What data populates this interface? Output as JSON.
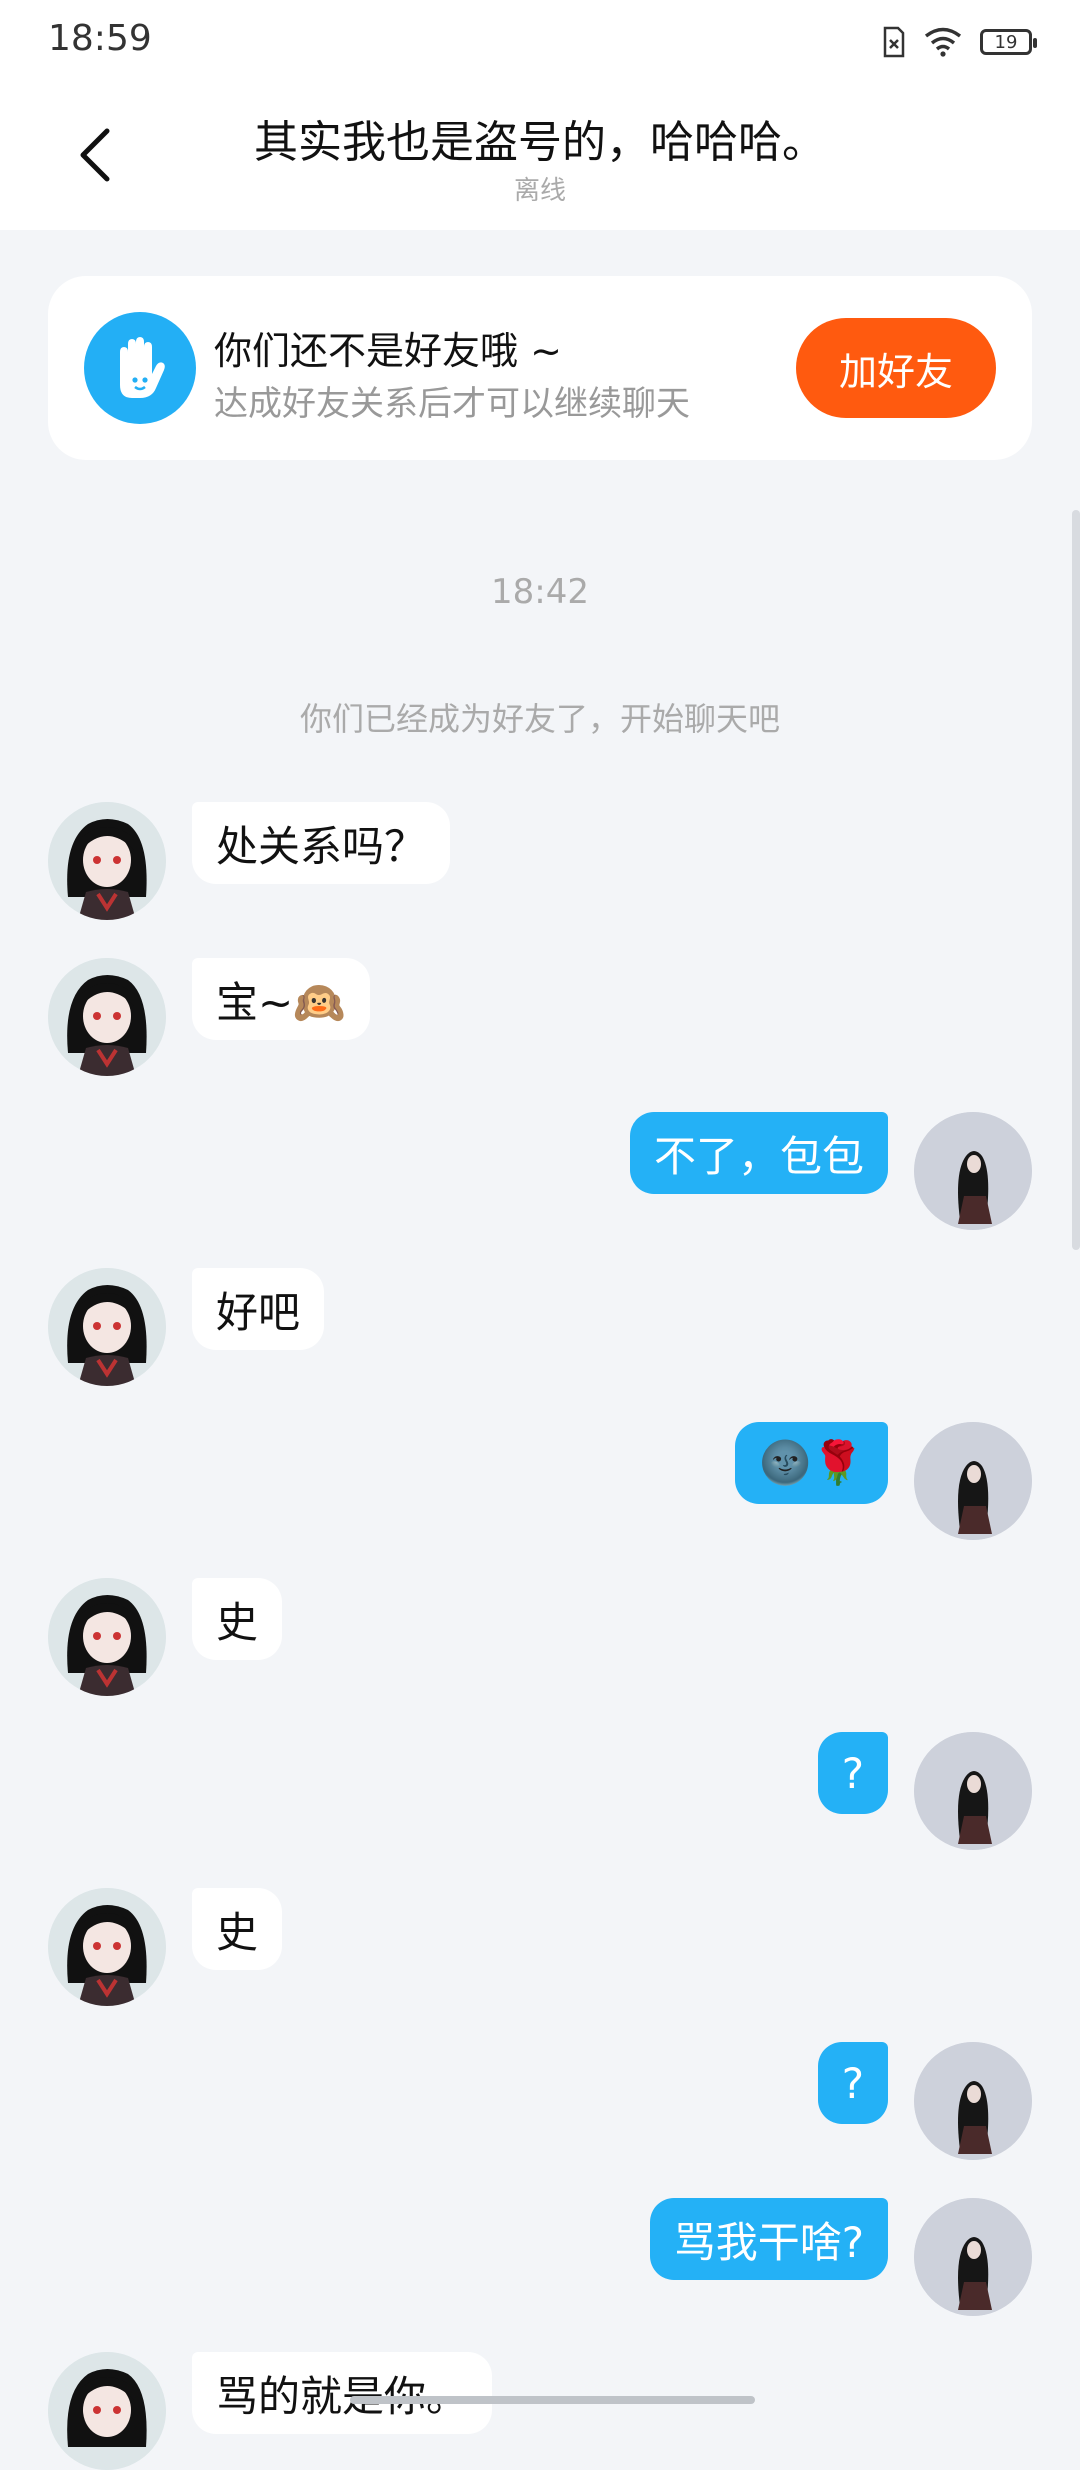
{
  "status": {
    "time": "18:59",
    "battery": "19"
  },
  "header": {
    "title": "其实我也是盗号的，哈哈哈。",
    "subtitle": "离线"
  },
  "friend_card": {
    "title": "你们还不是好友哦 ~",
    "subtitle": "达成好友关系后才可以继续聊天",
    "button": "加好友"
  },
  "chat": {
    "time": "18:42",
    "system": "你们已经成为好友了，开始聊天吧",
    "messages": [
      {
        "side": "left",
        "text": "处关系吗？"
      },
      {
        "side": "left",
        "text": "宝~🙉"
      },
      {
        "side": "right",
        "text": "不了，包包"
      },
      {
        "side": "left",
        "text": "好吧"
      },
      {
        "side": "right",
        "text": "🌚🌹"
      },
      {
        "side": "left",
        "text": "史"
      },
      {
        "side": "right",
        "text": "?"
      },
      {
        "side": "left",
        "text": "史"
      },
      {
        "side": "right",
        "text": "?"
      },
      {
        "side": "right",
        "text": "骂我干啥?"
      },
      {
        "side": "left",
        "text": "骂的就是你。"
      }
    ]
  },
  "colors": {
    "accent": "#24b1f6",
    "add_button": "#ff5a0f",
    "background": "#f3f5f8"
  }
}
